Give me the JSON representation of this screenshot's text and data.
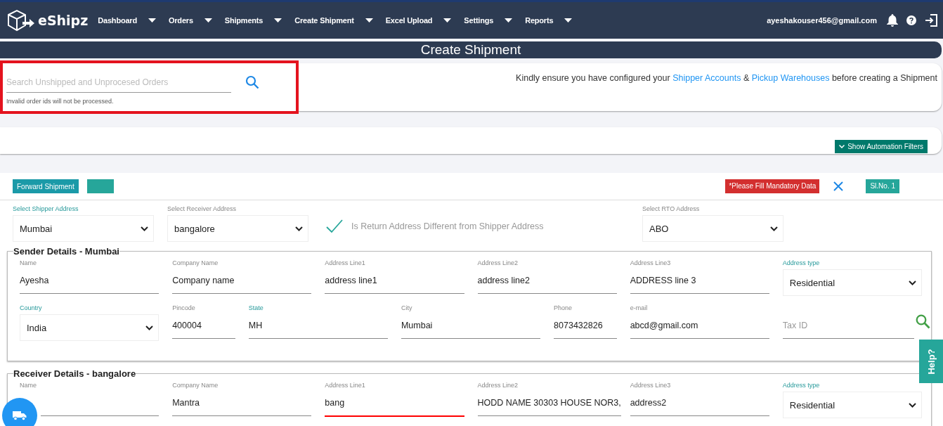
{
  "nav": {
    "brand": "eShipz",
    "menus": [
      {
        "label": "Dashboard"
      },
      {
        "label": "Orders"
      },
      {
        "label": "Shipments"
      },
      {
        "label": "Create Shipment"
      },
      {
        "label": "Excel Upload"
      },
      {
        "label": "Settings"
      },
      {
        "label": "Reports"
      }
    ],
    "user": "ayeshakouser456@gmail.com"
  },
  "page_title": "Create Shipment",
  "search": {
    "placeholder": "Search Unshipped and Unprocesed Orders",
    "hint": "Invalid order ids will not be processed."
  },
  "notice": {
    "before": "Kindly ensure you have configured your",
    "link_1": "Shipper Accounts",
    "middle": "&",
    "link_2": "Pickup Warehouses",
    "after": "before creating a Shipment"
  },
  "filters_button": "Show Automation Filters",
  "shipment": {
    "type_button": "Forward Shipment",
    "alert": "*Please Fill Mandatory Data",
    "serial": "Sl.No. 1",
    "address_selects": [
      {
        "label": "Select Shipper Address",
        "value": "Mumbai",
        "highlighted": true
      },
      {
        "label": "Select Receiver Address",
        "value": "bangalore",
        "highlighted": false
      }
    ],
    "return_check": {
      "label": "Is Return Address Different from Shipper Address",
      "checked": true
    },
    "rto_select": {
      "label": "Select RTO Address",
      "value": "ABO"
    },
    "sections": [
      {
        "title": "Sender Details - Mumbai",
        "fields": [
          {
            "kind": "text",
            "label": "Name",
            "value": "Ayesha",
            "highlighted": false,
            "error": false
          },
          {
            "kind": "text",
            "label": "Company Name",
            "value": "Company name",
            "highlighted": false,
            "error": false
          },
          {
            "kind": "text",
            "label": "Address Line1",
            "value": "address line1",
            "highlighted": false,
            "error": false
          },
          {
            "kind": "text",
            "label": "Address Line2",
            "value": "address line2",
            "highlighted": false,
            "error": false
          },
          {
            "kind": "text",
            "label": "Address Line3",
            "value": "ADDRESS line 3",
            "highlighted": false,
            "error": false
          },
          {
            "kind": "select",
            "label": "Address type",
            "value": "Residential",
            "highlighted": true,
            "error": false
          },
          {
            "kind": "select",
            "label": "Country",
            "value": "India",
            "highlighted": true,
            "error": false
          },
          {
            "kind": "text",
            "label": "Pincode",
            "value": "400004",
            "highlighted": false,
            "error": false
          },
          {
            "kind": "text",
            "label": "State",
            "value": "MH",
            "highlighted": true,
            "error": false
          },
          {
            "kind": "text",
            "label": "City",
            "value": "Mumbai",
            "highlighted": false,
            "error": false
          },
          {
            "kind": "text",
            "label": "Phone",
            "value": "8073432826",
            "highlighted": false,
            "error": false
          },
          {
            "kind": "text",
            "label": "e-mail",
            "value": "abcd@gmail.com",
            "highlighted": false,
            "error": false
          },
          {
            "kind": "lookup",
            "placeholder": "Tax ID",
            "highlighted": false,
            "error": false
          }
        ]
      },
      {
        "title": "Receiver Details - bangalore",
        "fields": [
          {
            "kind": "text",
            "label": "Name",
            "highlighted": false,
            "error": false
          },
          {
            "kind": "text",
            "label": "Company Name",
            "value": "Mantra",
            "highlighted": false,
            "error": false
          },
          {
            "kind": "text",
            "label": "Address Line1",
            "value": "bang",
            "highlighted": false,
            "error": true
          },
          {
            "kind": "text",
            "label": "Address Line2",
            "value": "HODD NAME 30303 HOUSE NOR3,",
            "highlighted": false,
            "error": false
          },
          {
            "kind": "text",
            "label": "Address Line3",
            "value": "address2",
            "highlighted": false,
            "error": false
          },
          {
            "kind": "select",
            "label": "Address type",
            "value": "Residential",
            "highlighted": true,
            "error": false
          }
        ]
      }
    ]
  },
  "help_tab": "Help?"
}
